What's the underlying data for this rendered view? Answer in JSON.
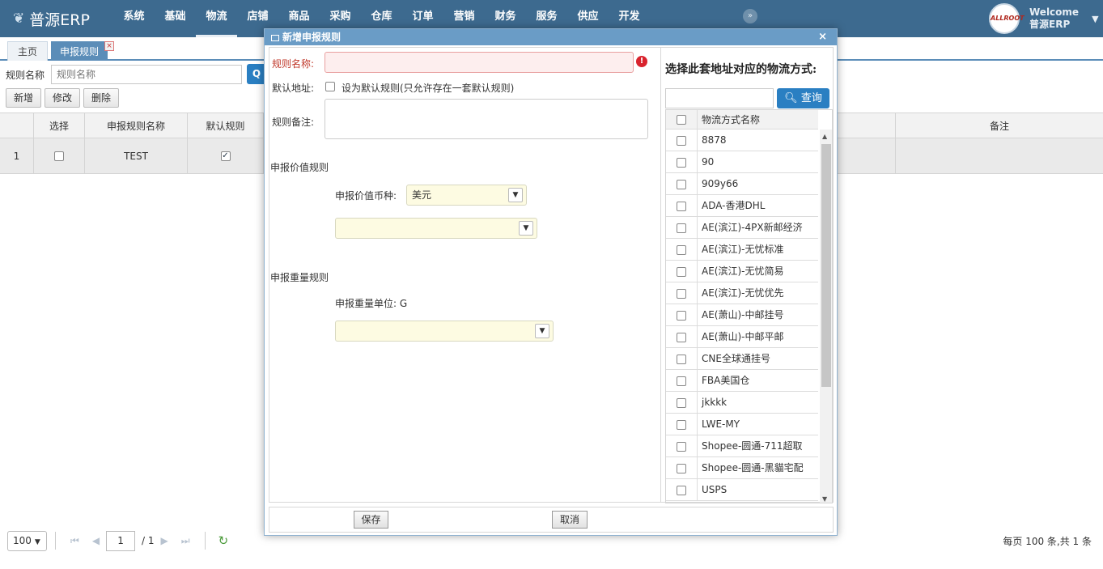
{
  "app": {
    "logo_text": "普源ERP",
    "nav": [
      "系统",
      "基础",
      "物流",
      "店铺",
      "商品",
      "采购",
      "仓库",
      "订单",
      "营销",
      "财务",
      "服务",
      "供应",
      "开发"
    ],
    "collapse_icon": "»",
    "user": {
      "avatar_text": "ALLROOT",
      "welcome": "Welcome",
      "name": "普源ERP"
    }
  },
  "tabs": {
    "home": "主页",
    "current": "申报规则",
    "close": "×"
  },
  "search": {
    "label": "规则名称",
    "placeholder": "规则名称"
  },
  "toolbar": {
    "add": "新增",
    "edit": "修改",
    "delete": "删除"
  },
  "grid": {
    "headers": {
      "select": "选择",
      "name": "申报规则名称",
      "default": "默认规则",
      "remark": "备注"
    },
    "rows": [
      {
        "index": "1",
        "name": "TEST",
        "default_checked": "✓"
      }
    ]
  },
  "pager": {
    "page_size": "100",
    "page": "1",
    "total_pages": "/ 1",
    "info": "每页 100 条,共 1 条"
  },
  "dialog": {
    "title": "新增申报规则",
    "close": "×",
    "name_label": "规则名称:",
    "error_icon": "!",
    "default_label": "默认地址:",
    "default_text": "设为默认规则(只允许存在一套默认规则)",
    "remark_label": "规则备注:",
    "value_section": "申报价值规则",
    "currency_label": "申报价值币种:",
    "currency_value": "美元",
    "weight_section": "申报重量规则",
    "weight_unit_label": "申报重量单位: G",
    "right_title": "选择此套地址对应的物流方式:",
    "query_button": "查询",
    "list_header": "物流方式名称",
    "logistics": [
      "8878",
      "90",
      "909y66",
      "ADA-香港DHL",
      "AE(滨江)-4PX新邮经济",
      "AE(滨江)-无忧标准",
      "AE(滨江)-无忧简易",
      "AE(滨江)-无忧优先",
      "AE(萧山)-中邮挂号",
      "AE(萧山)-中邮平邮",
      "CNE全球通挂号",
      "FBA美国仓",
      "jkkkk",
      "LWE-MY",
      "Shopee-圆通-711超取",
      "Shopee-圆通-黑貓宅配",
      "USPS"
    ],
    "save": "保存",
    "cancel": "取消"
  }
}
